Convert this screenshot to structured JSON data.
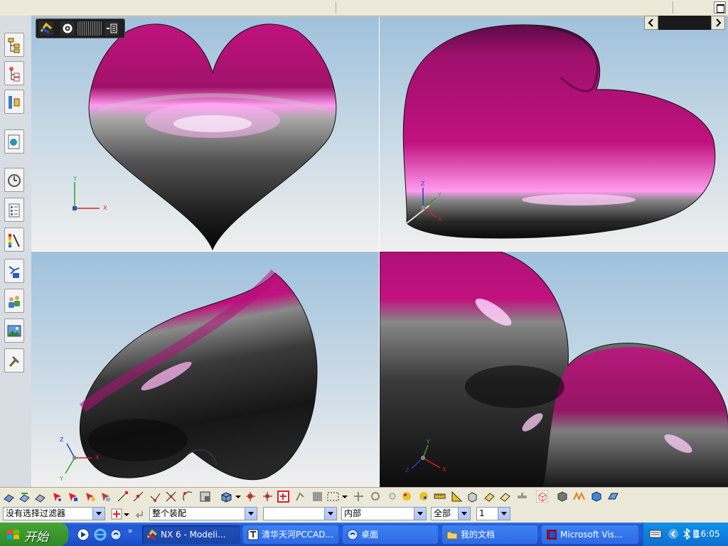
{
  "toolbar": {
    "filter_select": "没有选择过滤器",
    "assembly_scope": "整个装配",
    "empty_combo": "",
    "inner_combo": "内部",
    "all_combo": "全部",
    "number_combo": "1"
  },
  "viewports": {
    "top_left": {
      "axes": [
        "Y",
        "X"
      ]
    },
    "top_right": {
      "axes": [
        "Z",
        "Y",
        "X"
      ]
    },
    "bottom_left": {
      "axes": [
        "Z",
        "X",
        "Y"
      ]
    },
    "bottom_right": {
      "axes": [
        "Z",
        "Y",
        "X"
      ]
    }
  },
  "taskbar": {
    "start_label": "开始",
    "buttons": [
      {
        "label": "NX 6 - Modeli...",
        "icon": "nx-icon"
      },
      {
        "label": "清华天河PCCAD...",
        "icon": "pccad-icon"
      },
      {
        "label": "桌面",
        "icon": "desktop-icon"
      },
      {
        "label": "我的文档",
        "icon": "folder-icon"
      },
      {
        "label": "Microsoft Vis...",
        "icon": "visio-icon"
      }
    ],
    "clock": "16:05"
  },
  "colors": {
    "heart_magenta": "#c0117e",
    "heart_dark": "#141414",
    "viewport_top": "#9fc1dc",
    "viewport_bottom": "#f0f0ee",
    "taskbar_blue": "#245edb",
    "start_green": "#3c9a30"
  }
}
